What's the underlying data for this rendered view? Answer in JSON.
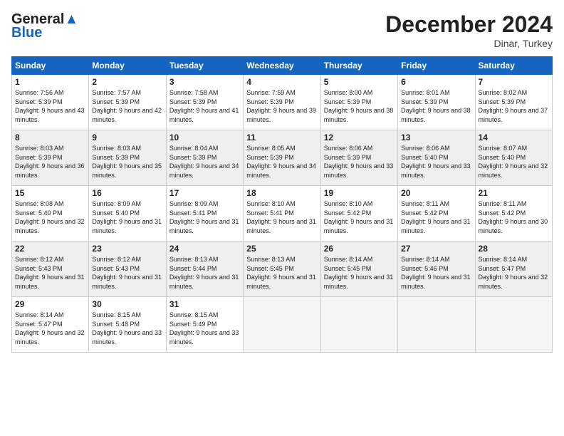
{
  "header": {
    "logo_line1": "General",
    "logo_line2": "Blue",
    "month_year": "December 2024",
    "location": "Dinar, Turkey"
  },
  "weekdays": [
    "Sunday",
    "Monday",
    "Tuesday",
    "Wednesday",
    "Thursday",
    "Friday",
    "Saturday"
  ],
  "weeks": [
    [
      {
        "day": "1",
        "sunrise": "7:56 AM",
        "sunset": "5:39 PM",
        "daylight": "9 hours and 43 minutes."
      },
      {
        "day": "2",
        "sunrise": "7:57 AM",
        "sunset": "5:39 PM",
        "daylight": "9 hours and 42 minutes."
      },
      {
        "day": "3",
        "sunrise": "7:58 AM",
        "sunset": "5:39 PM",
        "daylight": "9 hours and 41 minutes."
      },
      {
        "day": "4",
        "sunrise": "7:59 AM",
        "sunset": "5:39 PM",
        "daylight": "9 hours and 39 minutes."
      },
      {
        "day": "5",
        "sunrise": "8:00 AM",
        "sunset": "5:39 PM",
        "daylight": "9 hours and 38 minutes."
      },
      {
        "day": "6",
        "sunrise": "8:01 AM",
        "sunset": "5:39 PM",
        "daylight": "9 hours and 38 minutes."
      },
      {
        "day": "7",
        "sunrise": "8:02 AM",
        "sunset": "5:39 PM",
        "daylight": "9 hours and 37 minutes."
      }
    ],
    [
      {
        "day": "8",
        "sunrise": "8:03 AM",
        "sunset": "5:39 PM",
        "daylight": "9 hours and 36 minutes."
      },
      {
        "day": "9",
        "sunrise": "8:03 AM",
        "sunset": "5:39 PM",
        "daylight": "9 hours and 35 minutes."
      },
      {
        "day": "10",
        "sunrise": "8:04 AM",
        "sunset": "5:39 PM",
        "daylight": "9 hours and 34 minutes."
      },
      {
        "day": "11",
        "sunrise": "8:05 AM",
        "sunset": "5:39 PM",
        "daylight": "9 hours and 34 minutes."
      },
      {
        "day": "12",
        "sunrise": "8:06 AM",
        "sunset": "5:39 PM",
        "daylight": "9 hours and 33 minutes."
      },
      {
        "day": "13",
        "sunrise": "8:06 AM",
        "sunset": "5:40 PM",
        "daylight": "9 hours and 33 minutes."
      },
      {
        "day": "14",
        "sunrise": "8:07 AM",
        "sunset": "5:40 PM",
        "daylight": "9 hours and 32 minutes."
      }
    ],
    [
      {
        "day": "15",
        "sunrise": "8:08 AM",
        "sunset": "5:40 PM",
        "daylight": "9 hours and 32 minutes."
      },
      {
        "day": "16",
        "sunrise": "8:09 AM",
        "sunset": "5:40 PM",
        "daylight": "9 hours and 31 minutes."
      },
      {
        "day": "17",
        "sunrise": "8:09 AM",
        "sunset": "5:41 PM",
        "daylight": "9 hours and 31 minutes."
      },
      {
        "day": "18",
        "sunrise": "8:10 AM",
        "sunset": "5:41 PM",
        "daylight": "9 hours and 31 minutes."
      },
      {
        "day": "19",
        "sunrise": "8:10 AM",
        "sunset": "5:42 PM",
        "daylight": "9 hours and 31 minutes."
      },
      {
        "day": "20",
        "sunrise": "8:11 AM",
        "sunset": "5:42 PM",
        "daylight": "9 hours and 31 minutes."
      },
      {
        "day": "21",
        "sunrise": "8:11 AM",
        "sunset": "5:42 PM",
        "daylight": "9 hours and 30 minutes."
      }
    ],
    [
      {
        "day": "22",
        "sunrise": "8:12 AM",
        "sunset": "5:43 PM",
        "daylight": "9 hours and 31 minutes."
      },
      {
        "day": "23",
        "sunrise": "8:12 AM",
        "sunset": "5:43 PM",
        "daylight": "9 hours and 31 minutes."
      },
      {
        "day": "24",
        "sunrise": "8:13 AM",
        "sunset": "5:44 PM",
        "daylight": "9 hours and 31 minutes."
      },
      {
        "day": "25",
        "sunrise": "8:13 AM",
        "sunset": "5:45 PM",
        "daylight": "9 hours and 31 minutes."
      },
      {
        "day": "26",
        "sunrise": "8:14 AM",
        "sunset": "5:45 PM",
        "daylight": "9 hours and 31 minutes."
      },
      {
        "day": "27",
        "sunrise": "8:14 AM",
        "sunset": "5:46 PM",
        "daylight": "9 hours and 31 minutes."
      },
      {
        "day": "28",
        "sunrise": "8:14 AM",
        "sunset": "5:47 PM",
        "daylight": "9 hours and 32 minutes."
      }
    ],
    [
      {
        "day": "29",
        "sunrise": "8:14 AM",
        "sunset": "5:47 PM",
        "daylight": "9 hours and 32 minutes."
      },
      {
        "day": "30",
        "sunrise": "8:15 AM",
        "sunset": "5:48 PM",
        "daylight": "9 hours and 33 minutes."
      },
      {
        "day": "31",
        "sunrise": "8:15 AM",
        "sunset": "5:49 PM",
        "daylight": "9 hours and 33 minutes."
      },
      null,
      null,
      null,
      null
    ]
  ]
}
